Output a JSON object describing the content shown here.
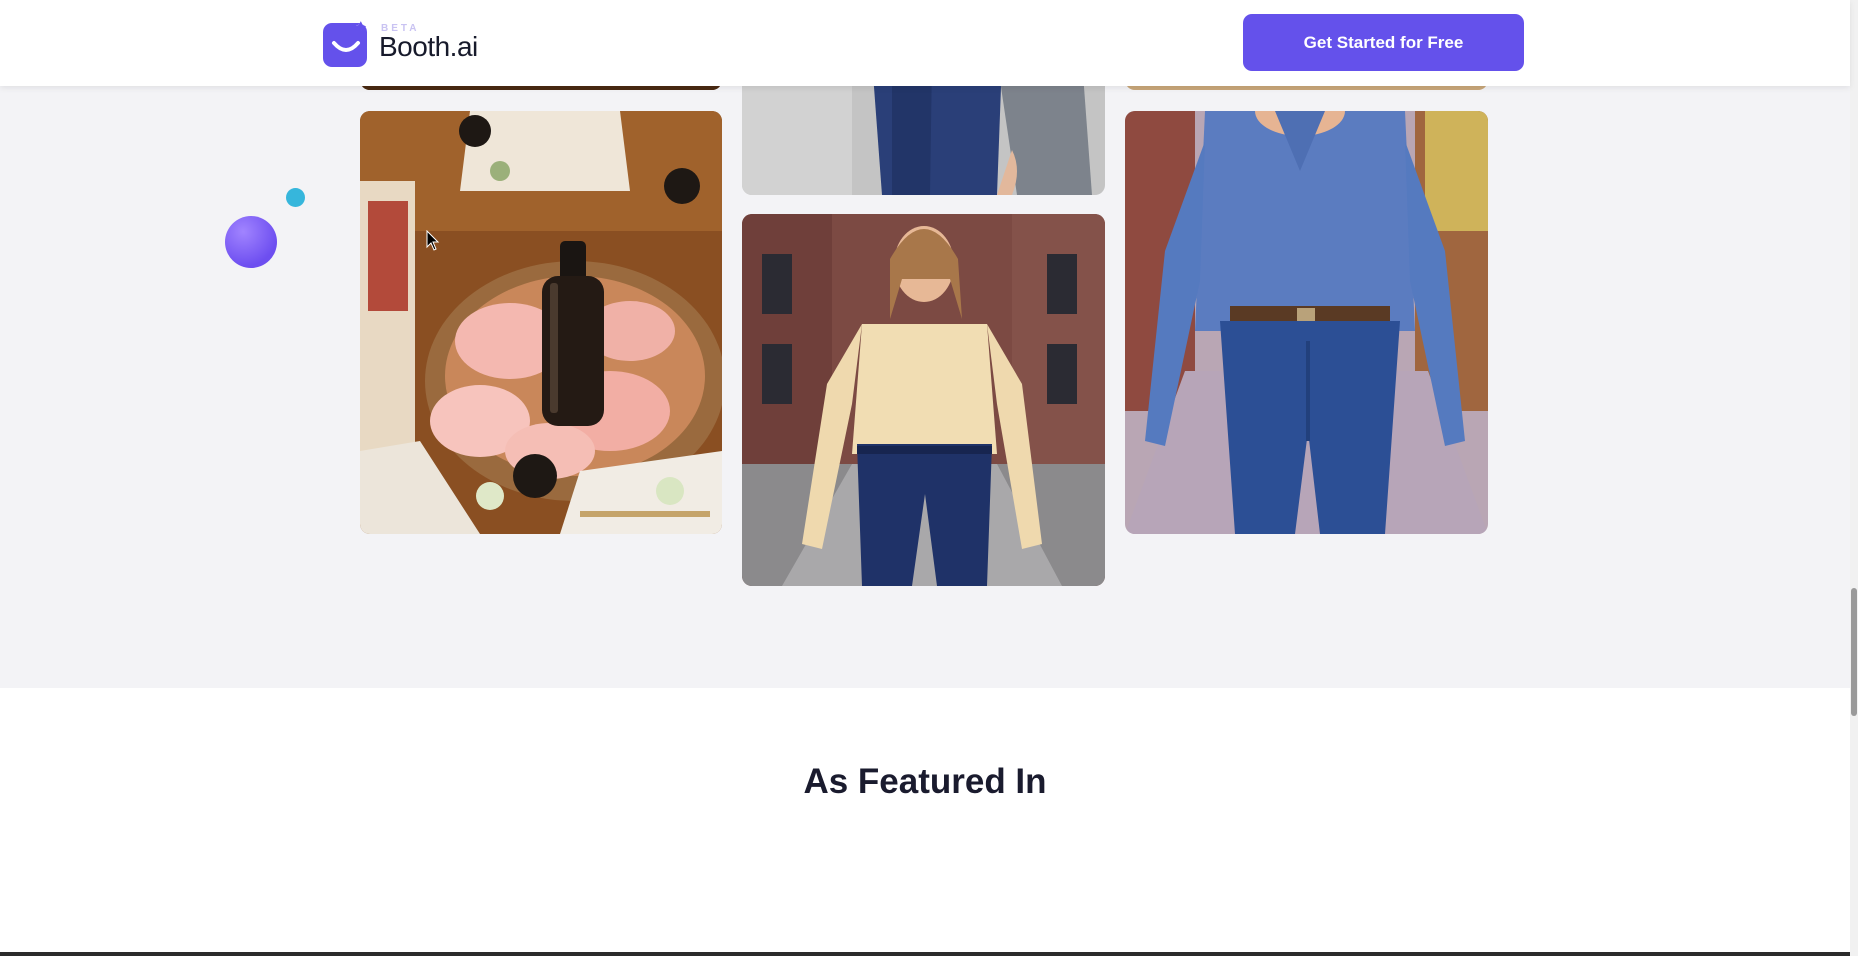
{
  "header": {
    "logo_badge": "BETA",
    "logo_name": "Booth.ai",
    "cta_label": "Get Started for Free"
  },
  "gallery": {
    "images": [
      {
        "subject": "serum-bottle-rose-petals-photo"
      },
      {
        "subject": "model-cream-blouse-jeans-photo"
      },
      {
        "subject": "model-denim-shirt-jeans-photo"
      },
      {
        "subject": "model-grey-coat-jeans-photo"
      }
    ]
  },
  "featured": {
    "title": "As Featured In"
  },
  "colors": {
    "accent": "#6451eb",
    "bubble_purple": "#7b5cf5",
    "bubble_cyan": "#36b6dc",
    "page_bg": "#f3f3f6"
  }
}
